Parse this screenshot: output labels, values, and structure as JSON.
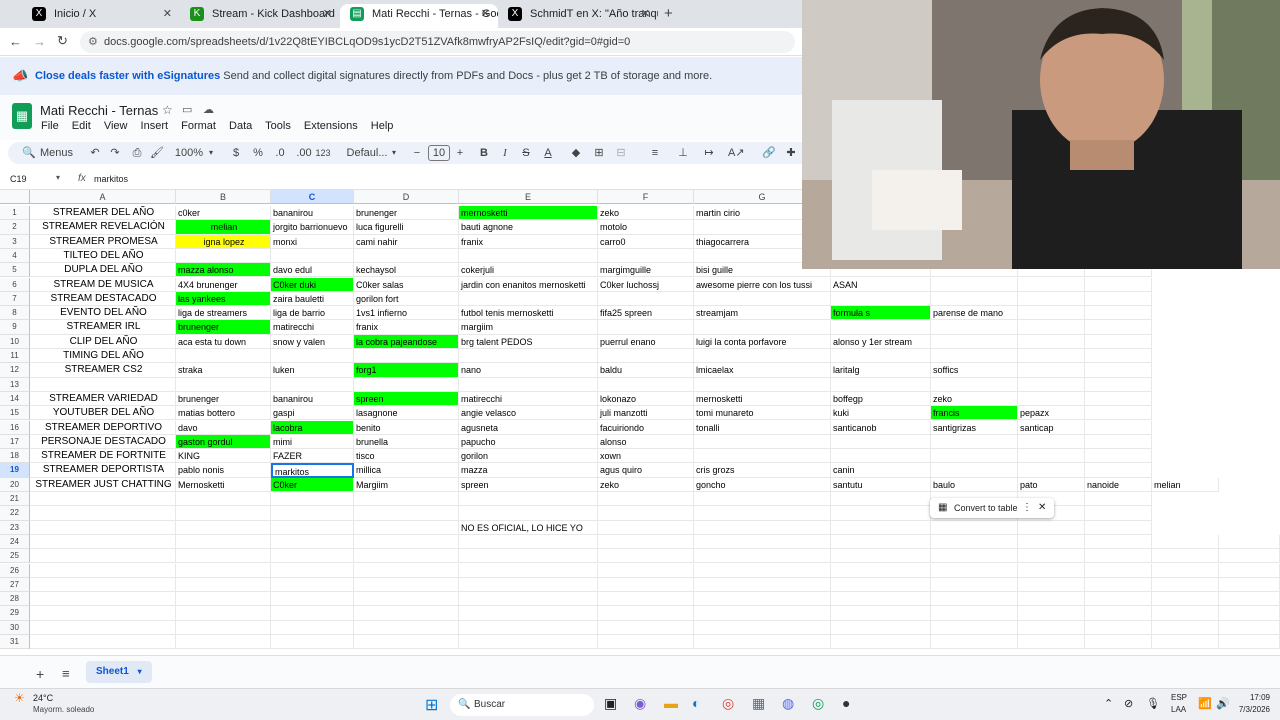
{
  "browser": {
    "tabs": [
      {
        "label": "Inicio / X",
        "icon": "x-logo-icon"
      },
      {
        "label": "Stream - Kick Dashboard",
        "icon": "kick-icon"
      },
      {
        "label": "Mati Recchi - Ternas - Google S",
        "icon": "sheets-icon"
      },
      {
        "label": "SchmidT en X: \"Año tranquilo n",
        "icon": "x-logo-icon"
      }
    ],
    "url": "docs.google.com/spreadsheets/d/1v22Q8tEYIBCLqOD9s1ycD2T51ZVAfk8mwfryAP2FsIQ/edit?gid=0#gid=0"
  },
  "banner": {
    "bold": "Close deals faster with eSignatures",
    "text": "Send and collect digital signatures directly from PDFs and Docs - plus get 2 TB of storage and more."
  },
  "doc": {
    "title": "Mati Recchi - Ternas",
    "menu": [
      "File",
      "Edit",
      "View",
      "Insert",
      "Format",
      "Data",
      "Tools",
      "Extensions",
      "Help"
    ]
  },
  "toolbar": {
    "search": "Menus",
    "zoom": "100%",
    "currency": "$",
    "percent": "%",
    "dec_less": ".0",
    "dec_more": ".00",
    "num_format": "123",
    "font": "Defaul...",
    "font_size": "10"
  },
  "formula": {
    "cell_ref": "C19",
    "value": "markitos"
  },
  "columns": [
    "A",
    "B",
    "C",
    "D",
    "E",
    "F",
    "G"
  ],
  "row_numbers": [
    "1",
    "2",
    "3",
    "4",
    "5",
    "6",
    "7",
    "8",
    "9",
    "10",
    "11",
    "12",
    "13",
    "14",
    "15",
    "16",
    "17",
    "18",
    "19",
    "20",
    "21",
    "22",
    "23",
    "24",
    "25",
    "26",
    "27",
    "28",
    "29",
    "30",
    "31"
  ],
  "rows": [
    [
      "STREAMER DEL AÑO",
      "c0ker",
      "bananirou",
      "brunenger",
      "mernosketti",
      "zeko",
      "martin cirio",
      "",
      "",
      "",
      ""
    ],
    [
      "STREAMER REVELACIÓN",
      "melian",
      "jorgito barrionuevo",
      "luca figurelli",
      "bauti agnone",
      "motolo",
      "",
      "",
      "",
      "",
      ""
    ],
    [
      "STREAMER PROMESA",
      "igna lopez",
      "monxi",
      "cami nahir",
      "franix",
      "carro0",
      "thiagocarrera",
      "",
      "",
      "",
      ""
    ],
    [
      "TILTEO DEL AÑO",
      "",
      "",
      "",
      "",
      "",
      "",
      "",
      "",
      "",
      ""
    ],
    [
      "DUPLA DEL AÑO",
      "mazza alonso",
      "davo edul",
      "kechaysol",
      "cokerjuli",
      "margimguille",
      "bisi guille",
      "",
      "",
      "",
      ""
    ],
    [
      "STREAM DE MUSICA",
      "4X4 brunenger",
      "C0ker duki",
      "C0ker salas",
      "jardin con enanitos mernosketti",
      "C0ker luchossj",
      "awesome pierre con los tussi",
      "ASAN",
      "",
      "",
      ""
    ],
    [
      "STREAM DESTACADO",
      "las yankees",
      "zaira bauletti",
      "gorilon fort",
      "",
      "",
      "",
      "",
      "",
      "",
      ""
    ],
    [
      "EVENTO DEL AÑO",
      "liga de streamers",
      "liga de barrio",
      "1vs1 infierno",
      "futbol tenis mernosketti",
      "fifa25 spreen",
      "streamjam",
      "formula s",
      "parense de mano",
      "",
      ""
    ],
    [
      "STREAMER IRL",
      "brunenger",
      "matirecchi",
      "franix",
      "margiim",
      "",
      "",
      "",
      "",
      "",
      ""
    ],
    [
      "CLIP DEL AÑO",
      "aca esta tu down",
      "snow y valen",
      "la cobra pajeandose",
      "brg talent PEDOS",
      "puerrul enano",
      "luigi la conta porfavore",
      "alonso y 1er stream",
      "",
      "",
      ""
    ],
    [
      "TIMING DEL AÑO",
      "",
      "",
      "",
      "",
      "",
      "",
      "",
      "",
      "",
      ""
    ],
    [
      "STREAMER CS2",
      "straka",
      "luken",
      "forg1",
      "nano",
      "baldu",
      "lmicaelax",
      "laritalg",
      "soffics",
      "",
      ""
    ],
    [
      "",
      "",
      "",
      "",
      "",
      "",
      "",
      "",
      "",
      "",
      ""
    ],
    [
      "STREAMER VARIEDAD",
      "brunenger",
      "bananirou",
      "spreen",
      "matirecchi",
      "lokonazo",
      "mernosketti",
      "boffegp",
      "zeko",
      "",
      ""
    ],
    [
      "YOUTUBER DEL AÑO",
      "matias bottero",
      "gaspi",
      "lasagnone",
      "angie velasco",
      "juli manzotti",
      "tomi munareto",
      "kuki",
      "francis",
      "pepazx",
      ""
    ],
    [
      "STREAMER DEPORTIVO",
      "davo",
      "lacobra",
      "benito",
      "agusneta",
      "facuiriondo",
      "tonalli",
      "santicanob",
      "santigrizas",
      "santicap",
      ""
    ],
    [
      "PERSONAJE DESTACADO",
      "gaston gordul",
      "mimi",
      "brunella",
      "papucho",
      "alonso",
      "",
      "",
      "",
      "",
      ""
    ],
    [
      "STREAMER DE FORTNITE",
      "KING",
      "FAZER",
      "tisco",
      "gorilon",
      "xown",
      "",
      "",
      "",
      "",
      ""
    ],
    [
      "STREAMER DEPORTISTA",
      "pablo nonis",
      "markitos",
      "millica",
      "mazza",
      "agus quiro",
      "cris grozs",
      "canin",
      "",
      "",
      ""
    ],
    [
      "STREAMER JUST CHATTING",
      "Mernosketti",
      "C0ker",
      "Margiim",
      "spreen",
      "zeko",
      "goncho",
      "santutu",
      "baulo",
      "pato",
      "nanoide",
      "melian"
    ],
    [
      "",
      "",
      "",
      "",
      "",
      "",
      "",
      "",
      "",
      "",
      ""
    ],
    [
      "",
      "",
      "",
      "",
      "",
      "",
      "",
      "",
      "",
      "",
      ""
    ],
    [
      "",
      "",
      "",
      "",
      "NO ES OFICIAL, LO HICE YO",
      "",
      "",
      "",
      "",
      "",
      ""
    ]
  ],
  "convert_popup": "Convert to table",
  "sheet_tab": "Sheet1",
  "taskbar": {
    "weather_temp": "24°C",
    "weather_desc": "Mayorm. soleado",
    "search": "Buscar",
    "lang": "ESP",
    "lang2": "LAA",
    "time": "17:09",
    "date": "7/3/2026"
  },
  "colors": {
    "green_fill": "#00ff00",
    "yellow_fill": "#ffff00",
    "accent": "#1a73e8"
  }
}
